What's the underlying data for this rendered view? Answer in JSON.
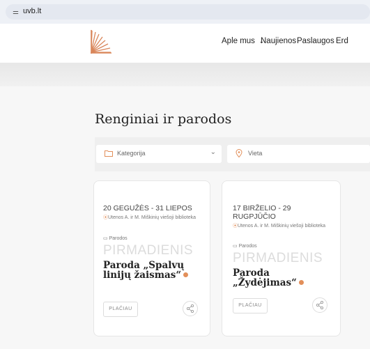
{
  "browser": {
    "url": "uvb.lt",
    "site_icon": "tune-icon"
  },
  "nav": {
    "items": [
      {
        "label": "Aple mus",
        "has_dropdown": true
      },
      {
        "label": "Naujienos",
        "has_dropdown": false
      },
      {
        "label": "Paslaugos",
        "has_dropdown": false
      },
      {
        "label": "Erd",
        "has_dropdown": false
      }
    ]
  },
  "main": {
    "heading": "Renginiai ir parodos"
  },
  "filters": {
    "category": {
      "placeholder": "Kategorija",
      "icon": "folder-icon"
    },
    "location": {
      "placeholder": "Vieta",
      "icon": "location-pin-icon"
    }
  },
  "events": [
    {
      "date": "20 GEGUŽĖS - 31 LIEPOS",
      "location": "Utenos A. ir M. Miškinių viešoji biblioteka",
      "category": "Parodos",
      "weekday": "PIRMADIENIS",
      "title": "Paroda „Spalvų linijų žaismas“",
      "button": "PLAČIAU"
    },
    {
      "date": "17 BIRŽELIO - 29 RUGPJŪČIO",
      "location": "Utenos A. ir M. Miškinių viešoji biblioteka",
      "category": "Parodos",
      "weekday": "PIRMADIENIS",
      "title": "Paroda „Žydėjimas“",
      "button": "PLAČIAU"
    }
  ],
  "colors": {
    "accent": "#e28f5a",
    "logo": "#d9865a"
  }
}
